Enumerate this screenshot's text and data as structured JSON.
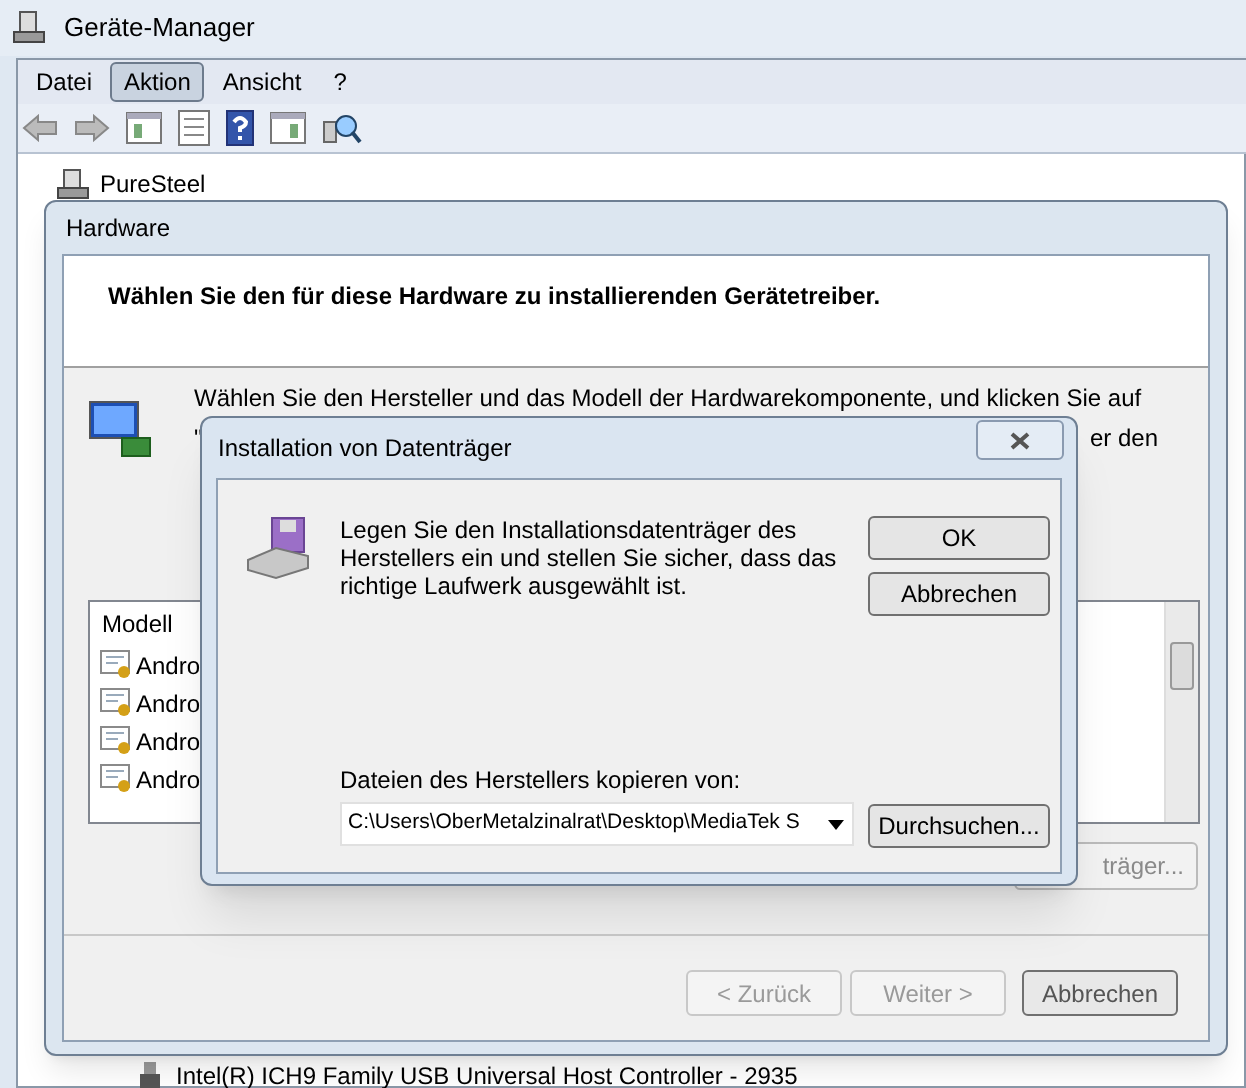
{
  "main_window": {
    "title": "Geräte-Manager",
    "menu": [
      {
        "label": "Datei",
        "selected": false
      },
      {
        "label": "Aktion",
        "selected": true
      },
      {
        "label": "Ansicht",
        "selected": false
      },
      {
        "label": "?",
        "selected": false
      }
    ],
    "tree": {
      "root": "PureSteel",
      "last_item": "Intel(R) ICH9 Family USB Universal Host Controller - 2935"
    }
  },
  "wizard": {
    "title": "Hardware",
    "heading": "Wählen Sie den für diese Hardware zu installierenden Gerätetreiber.",
    "intro_fragments": [
      "Wählen Sie den Hersteller und das Modell der Hardwarekomponente, und klicken Sie auf",
      "\"",
      "er den"
    ],
    "list_header": "Modell",
    "models": [
      "Andro",
      "Andro",
      "Andro",
      "Andro"
    ],
    "disk_button": "träger...",
    "buttons": [
      {
        "label": "< Zurück",
        "disabled": true
      },
      {
        "label": "Weiter >",
        "disabled": true
      },
      {
        "label": "Abbrechen",
        "disabled": false
      }
    ]
  },
  "disk_dialog": {
    "title": "Installation von Datenträger",
    "message": "Legen Sie den Installationsdatenträger des Herstellers ein und stellen Sie sicher, dass das richtige Laufwerk ausgewählt ist.",
    "ok": "OK",
    "cancel": "Abbrechen",
    "copy_label": "Dateien des Herstellers kopieren von:",
    "path": "C:\\Users\\OberMetalzinalrat\\Desktop\\MediaTek S",
    "browse": "Durchsuchen..."
  }
}
